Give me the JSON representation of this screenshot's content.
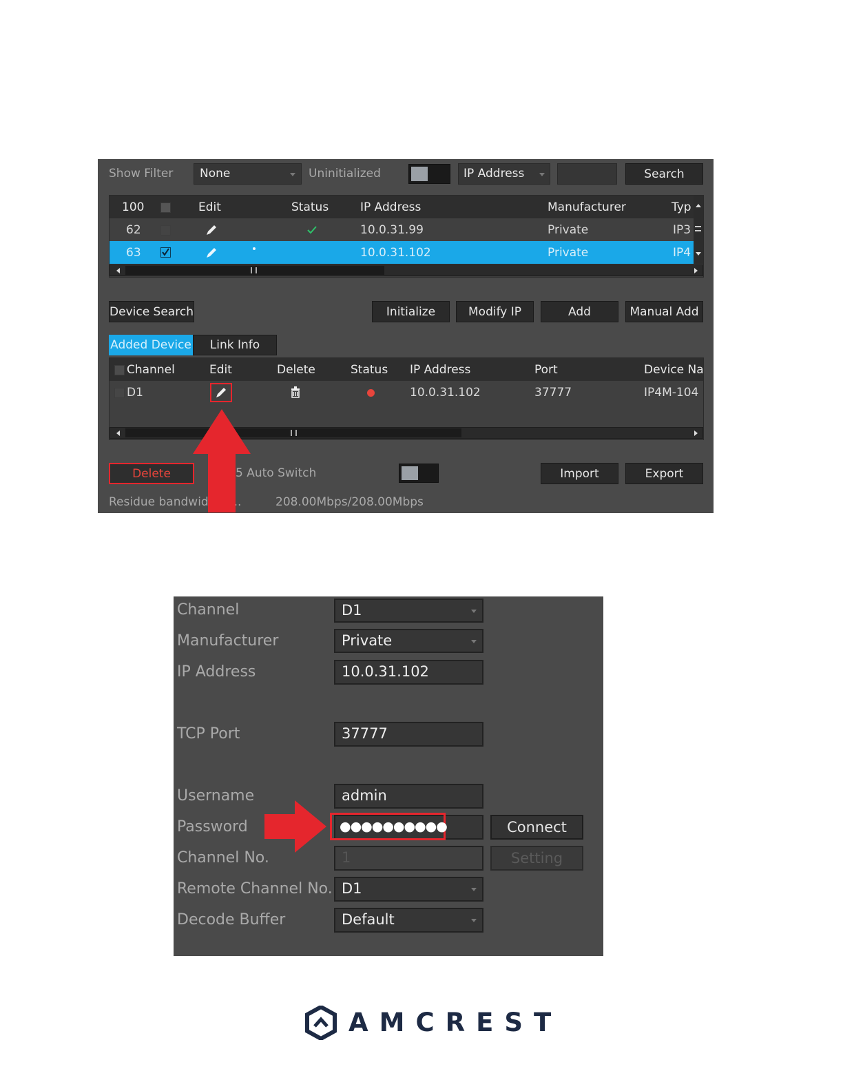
{
  "top_panel": {
    "show_filter_label": "Show Filter",
    "show_filter_value": "None",
    "uninitialized_label": "Uninitialized",
    "search_field_select": "IP Address",
    "search_button": "Search",
    "table": {
      "headers": [
        "100",
        "Edit",
        "Status",
        "IP Address",
        "Manufacturer",
        "Typ"
      ],
      "rows": [
        {
          "no": "62",
          "ip": "10.0.31.99",
          "manufacturer": "Private",
          "type": "IP3"
        },
        {
          "no": "63",
          "ip": "10.0.31.102",
          "manufacturer": "Private",
          "type": "IP4"
        }
      ]
    },
    "device_search_button": "Device Search",
    "initialize_button": "Initialize",
    "modify_ip_button": "Modify IP",
    "add_button": "Add",
    "manual_add_button": "Manual Add",
    "tabs": [
      "Added Device",
      "Link Info"
    ],
    "added_table": {
      "headers": [
        "Channel",
        "Edit",
        "Delete",
        "Status",
        "IP Address",
        "Port",
        "Device Na"
      ],
      "rows": [
        {
          "channel": "D1",
          "ip": "10.0.31.102",
          "port": "37777",
          "device_name": "IP4M-104"
        }
      ]
    },
    "delete_button": "Delete",
    "auto_switch_label": "5 Auto Switch",
    "import_button": "Import",
    "export_button": "Export",
    "residue_label": "Residue bandwidth/T...",
    "residue_value": "208.00Mbps/208.00Mbps"
  },
  "edit_panel": {
    "channel_label": "Channel",
    "channel_value": "D1",
    "manufacturer_label": "Manufacturer",
    "manufacturer_value": "Private",
    "ip_label": "IP Address",
    "ip_value": "10.0.31.102",
    "tcp_port_label": "TCP Port",
    "tcp_port_value": "37777",
    "username_label": "Username",
    "username_value": "admin",
    "password_label": "Password",
    "password_value": "●●●●●●●●●●",
    "connect_button": "Connect",
    "channel_no_label": "Channel No.",
    "channel_no_value": "1",
    "setting_button": "Setting",
    "remote_channel_label": "Remote Channel No.",
    "remote_channel_value": "D1",
    "decode_buffer_label": "Decode Buffer",
    "decode_buffer_value": "Default"
  },
  "logo": {
    "brand": "AMCREST"
  },
  "colors": {
    "panel": "#4a4a4a",
    "selection": "#1aa8e8",
    "highlight_red": "#e5262d",
    "logo": "#1d2a44"
  }
}
